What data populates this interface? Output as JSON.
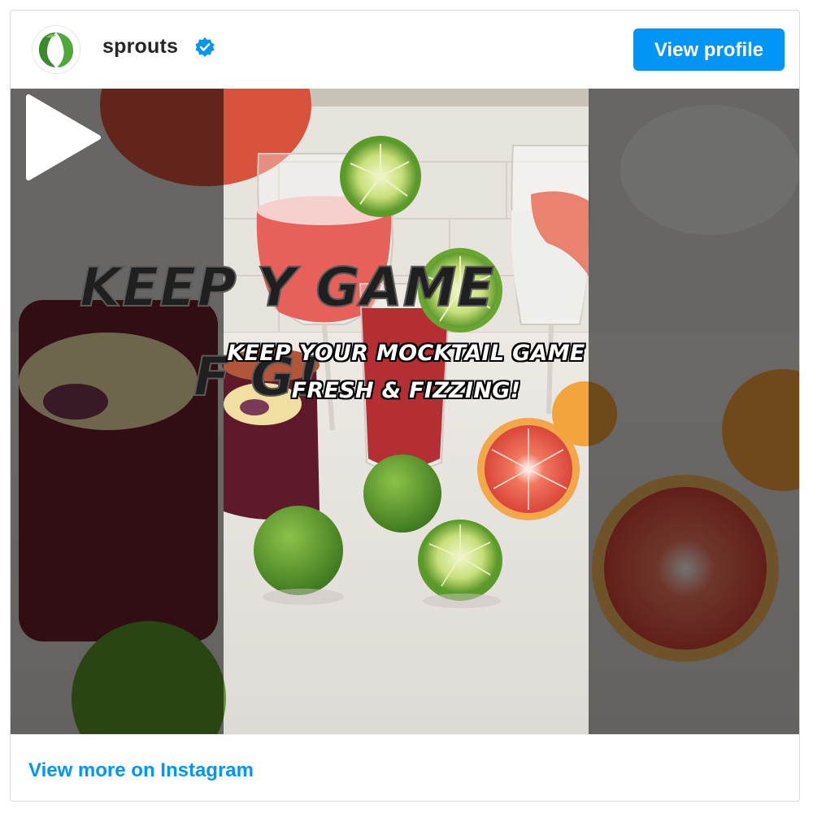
{
  "header": {
    "username": "sprouts",
    "verified_icon": "verified-badge-icon",
    "view_profile_label": "View profile"
  },
  "media": {
    "caption_line1": "KEEP YOUR MOCKTAIL GAME",
    "caption_line2": "FRESH & FIZZING!",
    "bg_caption_line1": "KEEP Y          GAME",
    "bg_caption_line2": "F                       G!",
    "play_icon": "play-icon"
  },
  "footer": {
    "view_more_label": "View more on Instagram"
  },
  "colors": {
    "accent": "#0095f6",
    "username": "#262626",
    "border": "#dbdbdb"
  }
}
